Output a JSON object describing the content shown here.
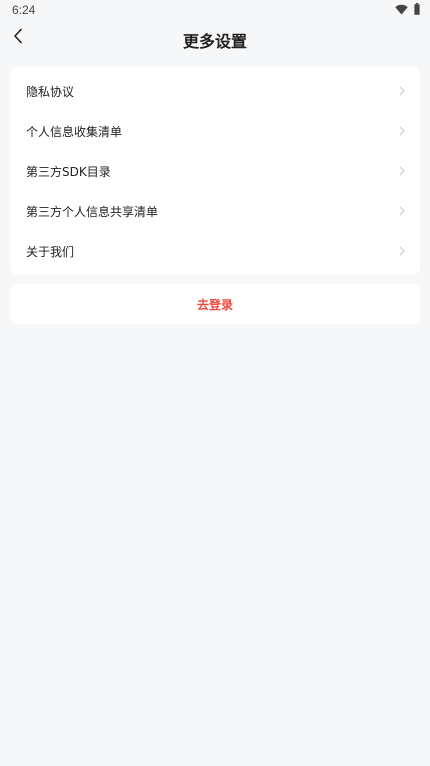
{
  "status_bar": {
    "time": "6:24",
    "icons": [
      "wifi-icon",
      "battery-icon"
    ]
  },
  "header": {
    "title": "更多设置",
    "back_icon": "chevron-left-icon"
  },
  "settings": {
    "items": [
      {
        "label": "隐私协议"
      },
      {
        "label": "个人信息收集清单"
      },
      {
        "label": "第三方SDK目录"
      },
      {
        "label": "第三方个人信息共享清单"
      },
      {
        "label": "关于我们"
      }
    ]
  },
  "login": {
    "label": "去登录",
    "color": "#ee4a3d"
  },
  "colors": {
    "background": "#f6f7f9",
    "card": "#ffffff",
    "chevron": "#c8c8c8"
  }
}
